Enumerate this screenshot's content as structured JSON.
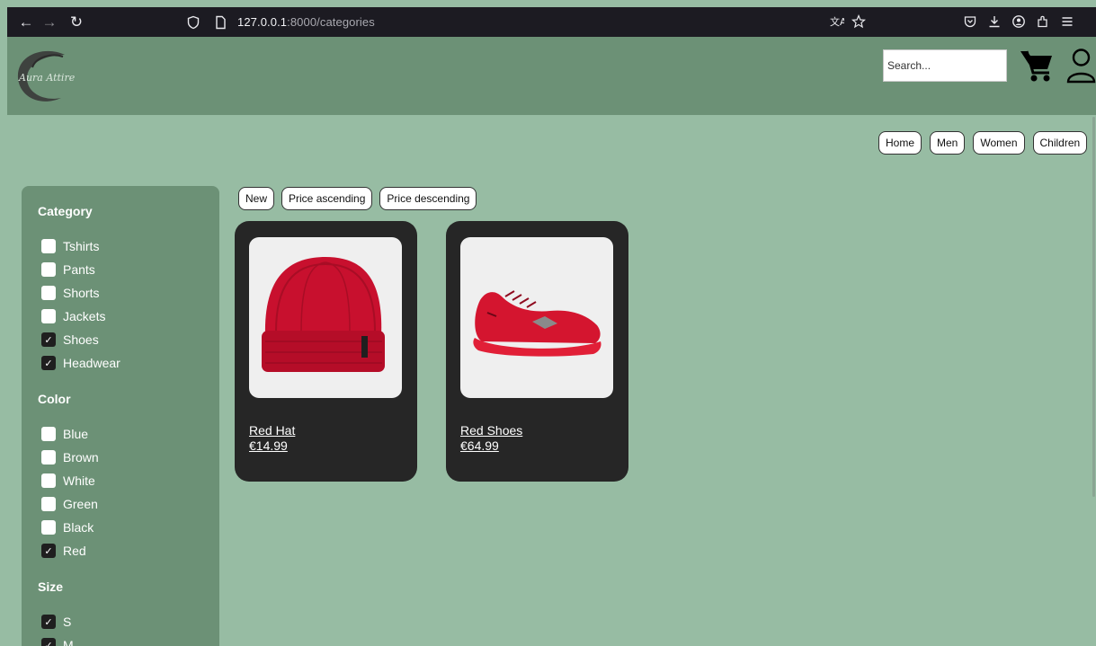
{
  "browser": {
    "url_host": "127.0.0.1",
    "url_rest": ":8000/categories"
  },
  "header": {
    "logo_text": "Aura Attire",
    "search_placeholder": "Search..."
  },
  "nav": {
    "items": [
      "Home",
      "Men",
      "Women",
      "Children"
    ]
  },
  "sort": {
    "buttons": [
      "New",
      "Price ascending",
      "Price descending"
    ]
  },
  "filters": {
    "category": {
      "heading": "Category",
      "options": [
        {
          "label": "Tshirts",
          "checked": false
        },
        {
          "label": "Pants",
          "checked": false
        },
        {
          "label": "Shorts",
          "checked": false
        },
        {
          "label": "Jackets",
          "checked": false
        },
        {
          "label": "Shoes",
          "checked": true
        },
        {
          "label": "Headwear",
          "checked": true
        }
      ]
    },
    "color": {
      "heading": "Color",
      "options": [
        {
          "label": "Blue",
          "checked": false
        },
        {
          "label": "Brown",
          "checked": false
        },
        {
          "label": "White",
          "checked": false
        },
        {
          "label": "Green",
          "checked": false
        },
        {
          "label": "Black",
          "checked": false
        },
        {
          "label": "Red",
          "checked": true
        }
      ]
    },
    "size": {
      "heading": "Size",
      "options": [
        {
          "label": "S",
          "checked": true
        },
        {
          "label": "M",
          "checked": true
        }
      ]
    }
  },
  "products": [
    {
      "name": "Red Hat",
      "price": "€14.99"
    },
    {
      "name": "Red Shoes",
      "price": "€64.99"
    }
  ],
  "colors": {
    "header_green": "#6c9176",
    "page_green": "#97bca3",
    "card_dark": "#262626",
    "product_red": "#c8102e"
  }
}
